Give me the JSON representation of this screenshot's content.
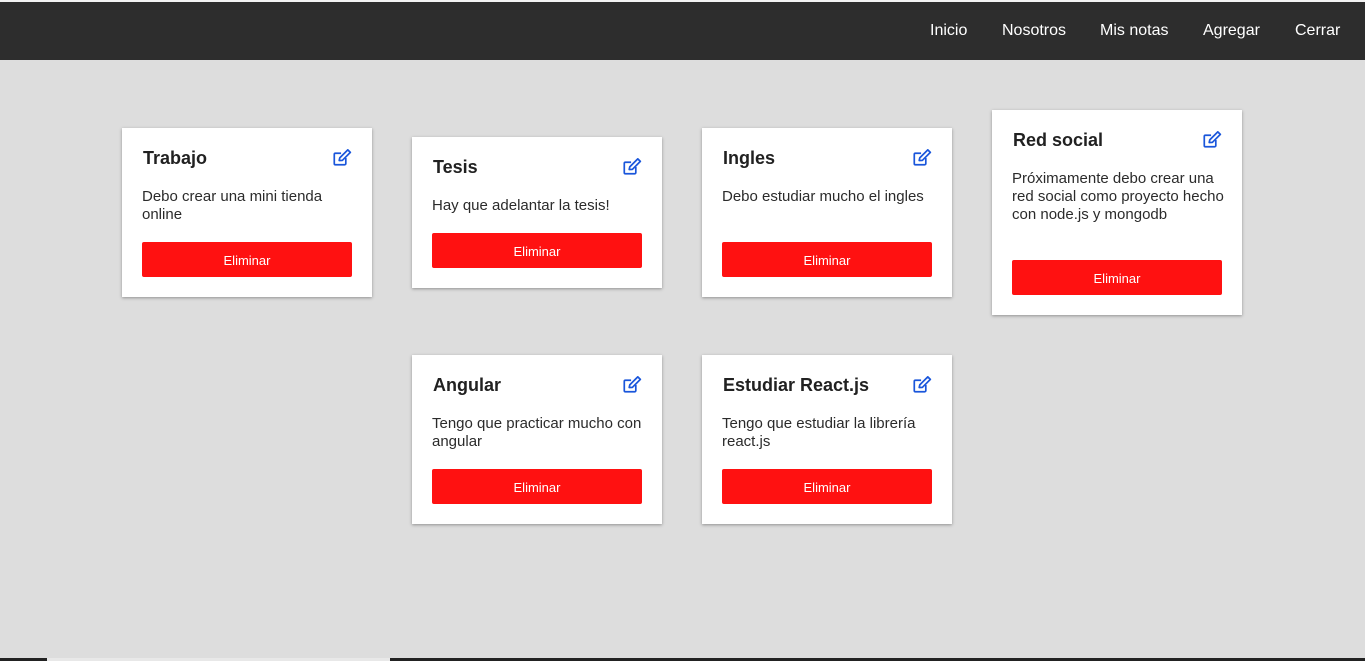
{
  "navbar": {
    "links": [
      {
        "label": "Inicio"
      },
      {
        "label": "Nosotros"
      },
      {
        "label": "Mis notas"
      },
      {
        "label": "Agregar"
      },
      {
        "label": "Cerrar"
      }
    ]
  },
  "colors": {
    "navbar_bg": "#2d2d2d",
    "page_bg": "#dddddd",
    "delete_button": "#ff1111",
    "edit_icon": "#1a56db"
  },
  "icons": {
    "edit": "edit-icon"
  },
  "notes": [
    {
      "title": "Trabajo",
      "text": "Debo crear una mini tienda online",
      "button": "Eliminar"
    },
    {
      "title": "Tesis",
      "text": "Hay que adelantar la tesis!",
      "button": "Eliminar"
    },
    {
      "title": "Ingles",
      "text": "Debo estudiar mucho el ingles",
      "button": "Eliminar"
    },
    {
      "title": "Red social",
      "text": "Próximamente debo crear una red social como proyecto hecho con node.js y mongodb",
      "button": "Eliminar"
    },
    {
      "title": "Angular",
      "text": "Tengo que practicar mucho con angular",
      "button": "Eliminar"
    },
    {
      "title": "Estudiar React.js",
      "text": "Tengo que estudiar la librería react.js",
      "button": "Eliminar"
    }
  ]
}
